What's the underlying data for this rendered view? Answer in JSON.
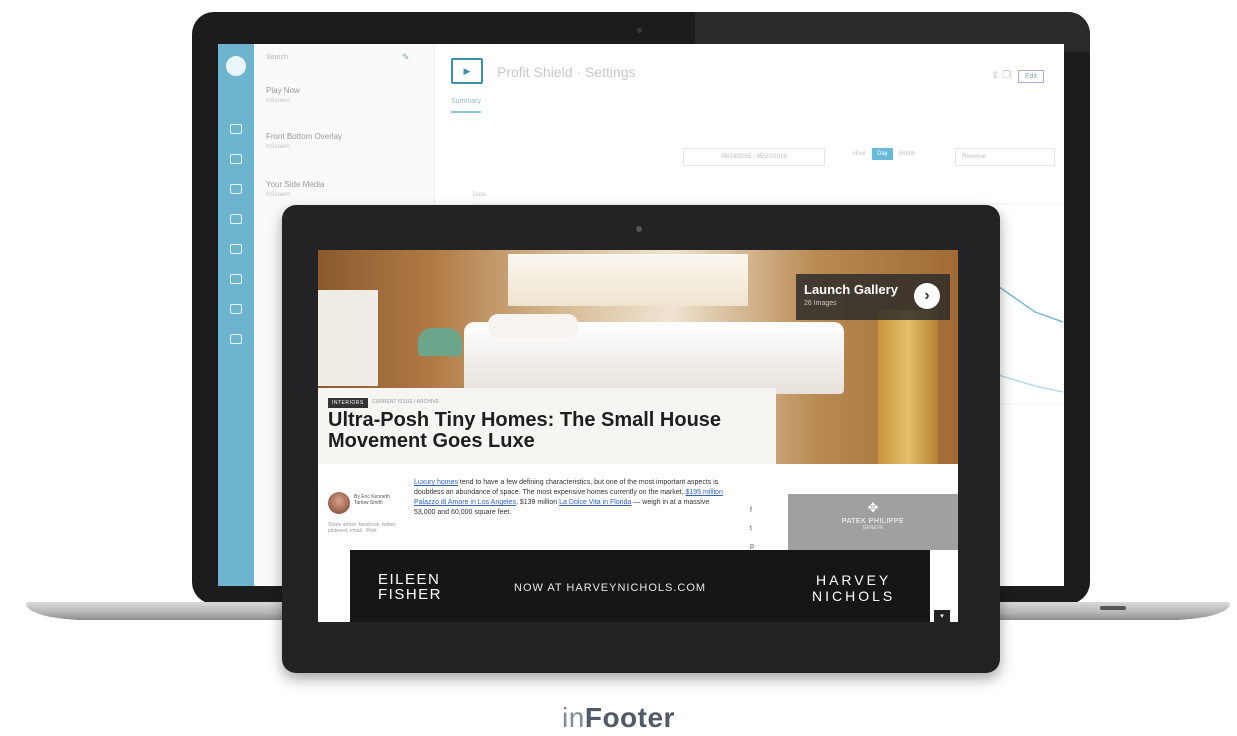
{
  "dashboard": {
    "search_placeholder": "Search",
    "new_icon": "pencil-icon",
    "list_items": [
      {
        "title": "Play Now",
        "subtitle": "inScreen"
      },
      {
        "title": "Front Bottom Overlay",
        "subtitle": "inScreen"
      },
      {
        "title": "Your Side Media",
        "subtitle": "inScreen"
      }
    ],
    "title": "Profit Shield · Settings",
    "tab": "Summary",
    "date_range": "05/14/2015 - 05/20/2015",
    "granularity": [
      "Hour",
      "Day",
      "Month"
    ],
    "granularity_selected": "Day",
    "metric": "Revenue",
    "data_label": "Data",
    "top_button": "Edit",
    "blue_button_label": "+"
  },
  "article": {
    "launch_title": "Launch Gallery",
    "launch_subtitle": "26 Images",
    "launch_arrow": "›",
    "tag": "INTERIORS",
    "kicker": "CURRENT ISSUE / ARCHIVE",
    "headline": "Ultra-Posh Tiny Homes: The Small House Movement Goes Luxe",
    "author_name": "By Eric Kenneth Tarlow Smith",
    "author_meta": "Share article: facebook, twitter, pinterest, email · Print",
    "body_parts": [
      {
        "text": "Luxury homes",
        "link": true
      },
      {
        "text": " tend to have a few defining characteristics, but one of the most important aspects is doubtless an abundance of space. The most expensive homes currently on the market, ",
        "link": false
      },
      {
        "text": "$195 million Palazzo di Amore in Los Angeles",
        "link": true
      },
      {
        "text": ", $139 million ",
        "link": false
      },
      {
        "text": "La Dolce Vita in Florida",
        "link": true
      },
      {
        "text": " — weigh in at a massive 53,000 and 60,000 square feet.",
        "link": false
      }
    ],
    "share_icons": [
      "facebook-icon",
      "twitter-icon",
      "pinterest-icon"
    ],
    "side_ad_name": "PATEK PHILIPPE",
    "side_ad_sub": "GENEVE",
    "footer_ad": {
      "brand": "EILEEN\nFISHER",
      "cta": "NOW AT HARVEYNICHOLS.COM",
      "partner": "HARVEY\nNICHOLS",
      "close": "▾"
    }
  },
  "caption": {
    "prefix": "in",
    "suffix": "Footer"
  },
  "colors": {
    "rail": "#6db4cf",
    "accent": "#3b8fb3",
    "device": "#1c1c1e",
    "caption": "#5e6b77"
  }
}
